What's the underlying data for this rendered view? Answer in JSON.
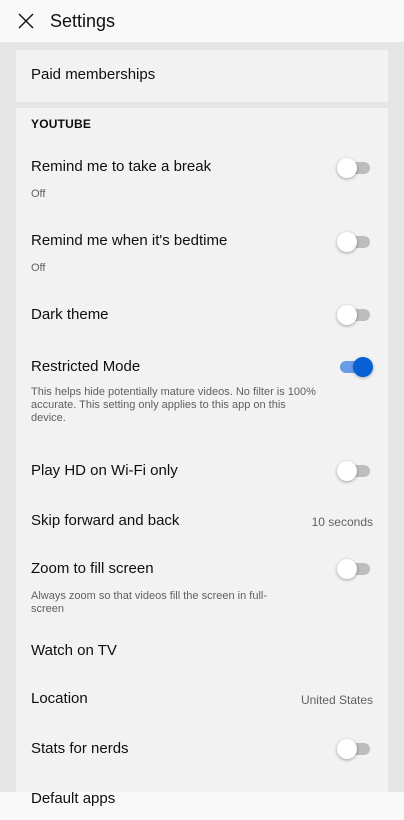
{
  "header": {
    "title": "Settings",
    "close_icon": "close-icon"
  },
  "paid_memberships": {
    "label": "Paid memberships"
  },
  "youtube_section": {
    "heading": "YOUTUBE"
  },
  "items": {
    "take_break": {
      "label": "Remind me to take a break",
      "sub": "Off",
      "toggle": false
    },
    "bedtime": {
      "label": "Remind me when it's bedtime",
      "sub": "Off",
      "toggle": false
    },
    "dark_theme": {
      "label": "Dark theme",
      "toggle": false
    },
    "restricted": {
      "label": "Restricted Mode",
      "sub": "This helps hide potentially mature videos. No filter is 100% accurate. This setting only applies to this app on this device.",
      "toggle": true
    },
    "play_hd": {
      "label": "Play HD on Wi-Fi only",
      "toggle": false
    },
    "skip": {
      "label": "Skip forward and back",
      "value": "10 seconds"
    },
    "zoom": {
      "label": "Zoom to fill screen",
      "sub": "Always zoom so that videos fill the screen in full-screen",
      "toggle": false
    },
    "watch_tv": {
      "label": "Watch on TV"
    },
    "location": {
      "label": "Location",
      "value": "United States"
    },
    "stats": {
      "label": "Stats for nerds",
      "toggle": false
    },
    "default_apps": {
      "label": "Default apps"
    }
  },
  "colors": {
    "accent": "#065fd4",
    "accent_track": "#6a9be8",
    "background": "#f9f9f9",
    "card": "#f2f2f2",
    "divider": "#e5e5e5"
  }
}
